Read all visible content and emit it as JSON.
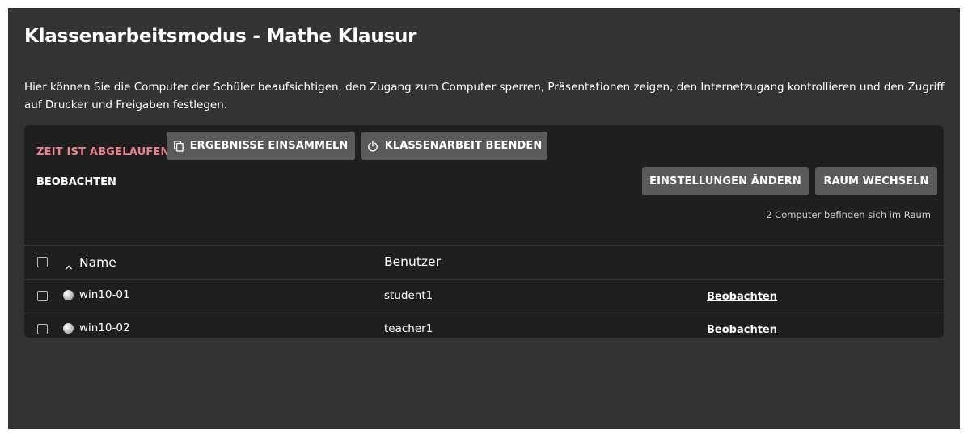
{
  "page": {
    "title": "Klassenarbeitsmodus - Mathe Klausur",
    "description": "Hier können Sie die Computer der Schüler beaufsichtigen, den Zugang zum Computer sperren, Präsentationen zeigen, den Internetzugang kontrollieren und den Zugriff auf Drucker und Freigaben festlegen."
  },
  "toolbar": {
    "status_text": "ZEIT IST ABGELAUFEN",
    "status_color": "#e8848f",
    "collect_label": "ERGEBNISSE EINSAMMELN",
    "collect_icon": "copy-icon",
    "end_label": "KLASSENARBEIT BEENDEN",
    "end_icon": "power-icon"
  },
  "observe_bar": {
    "label": "BEOBACHTEN",
    "settings_label": "EINSTELLUNGEN ÄNDERN",
    "room_label": "RAUM WECHSELN",
    "count_text": "2 Computer befinden sich im Raum"
  },
  "table": {
    "sort_icon": "chevron-up-icon",
    "headers": {
      "name": "Name",
      "user": "Benutzer"
    },
    "rows": [
      {
        "name": "win10-01",
        "user": "student1",
        "action": "Beobachten",
        "checked": false
      },
      {
        "name": "win10-02",
        "user": "teacher1",
        "action": "Beobachten",
        "checked": false
      }
    ]
  },
  "colors": {
    "background": "#333333",
    "panel": "#1f1f1f",
    "button": "#5a5a5a"
  }
}
